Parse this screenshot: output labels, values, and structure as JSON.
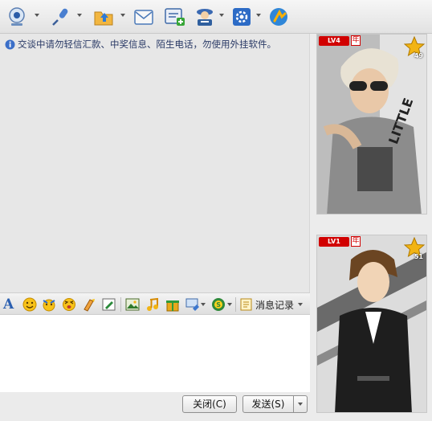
{
  "toolbar": {
    "items": [
      {
        "icon": "video-camera-icon"
      },
      {
        "icon": "microphone-icon"
      },
      {
        "icon": "send-file-folder-icon"
      },
      {
        "icon": "email-icon"
      },
      {
        "icon": "create-group-icon"
      },
      {
        "icon": "contact-card-icon"
      },
      {
        "icon": "app-settings-icon"
      },
      {
        "icon": "remote-assist-icon"
      }
    ]
  },
  "chat": {
    "notice": "交谈中请勿轻信汇款、中奖信息、陌生电话，勿使用外挂软件。"
  },
  "format_bar": {
    "font_glyph": "A",
    "icons": [
      "font-icon",
      "emoji-icon",
      "magic-face-icon",
      "shake-icon",
      "scribble-icon",
      "handwrite-icon",
      "image-icon",
      "music-icon",
      "gift-icon",
      "screenshot-icon",
      "payment-icon"
    ],
    "history_label": "消息记录"
  },
  "buttons": {
    "close_label": "关闭(C)",
    "send_label": "发送(S)"
  },
  "show_panel": {
    "cards": [
      {
        "level": "LV4",
        "year": "年",
        "star_count": "49"
      },
      {
        "level": "LV1",
        "year": "年",
        "star_count": "51"
      }
    ]
  },
  "colors": {
    "notice_text": "#2a3a66",
    "badge_red": "#d10000",
    "star_gold": "#f2b414"
  }
}
